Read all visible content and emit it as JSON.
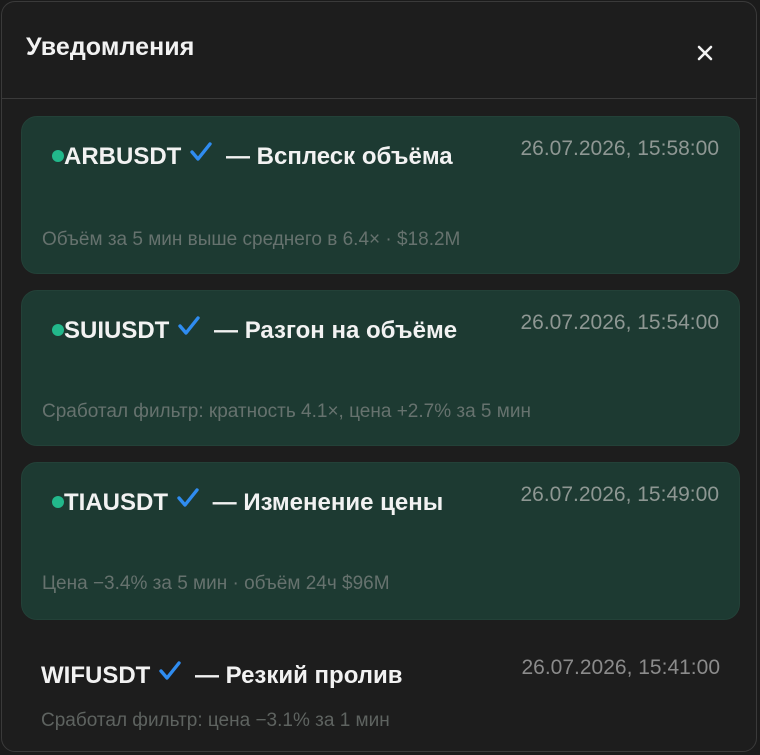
{
  "header": {
    "title": "Уведомления",
    "close_icon": "close-icon"
  },
  "notifications": [
    {
      "symbol": "ARBUSDT",
      "separator": " — ",
      "event": "Всплеск объёма",
      "time": "26.07.2026, 15:58:00",
      "description": "Объём за 5 мин выше среднего в 6.4× · $18.2M",
      "unread": true
    },
    {
      "symbol": "SUIUSDT",
      "separator": " — ",
      "event": "Разгон на объёме",
      "time": "26.07.2026, 15:54:00",
      "description": "Сработал фильтр: кратность 4.1×, цена +2.7% за 5 мин",
      "unread": true
    },
    {
      "symbol": "TIAUSDT",
      "separator": " — ",
      "event": "Изменение цены",
      "time": "26.07.2026, 15:49:00",
      "description": "Цена −3.4% за 5 мин · объём 24ч $96M",
      "unread": true
    },
    {
      "symbol": "WIFUSDT",
      "separator": " — ",
      "event": "Резкий пролив",
      "time": "26.07.2026, 15:41:00",
      "description": "Сработал фильтр: цена −3.1% за 1 мин",
      "unread": false
    }
  ],
  "colors": {
    "unread_dot": "#22b88b",
    "verified_check": "#2f8cf0",
    "unread_card_bg": "#1d3a32"
  }
}
